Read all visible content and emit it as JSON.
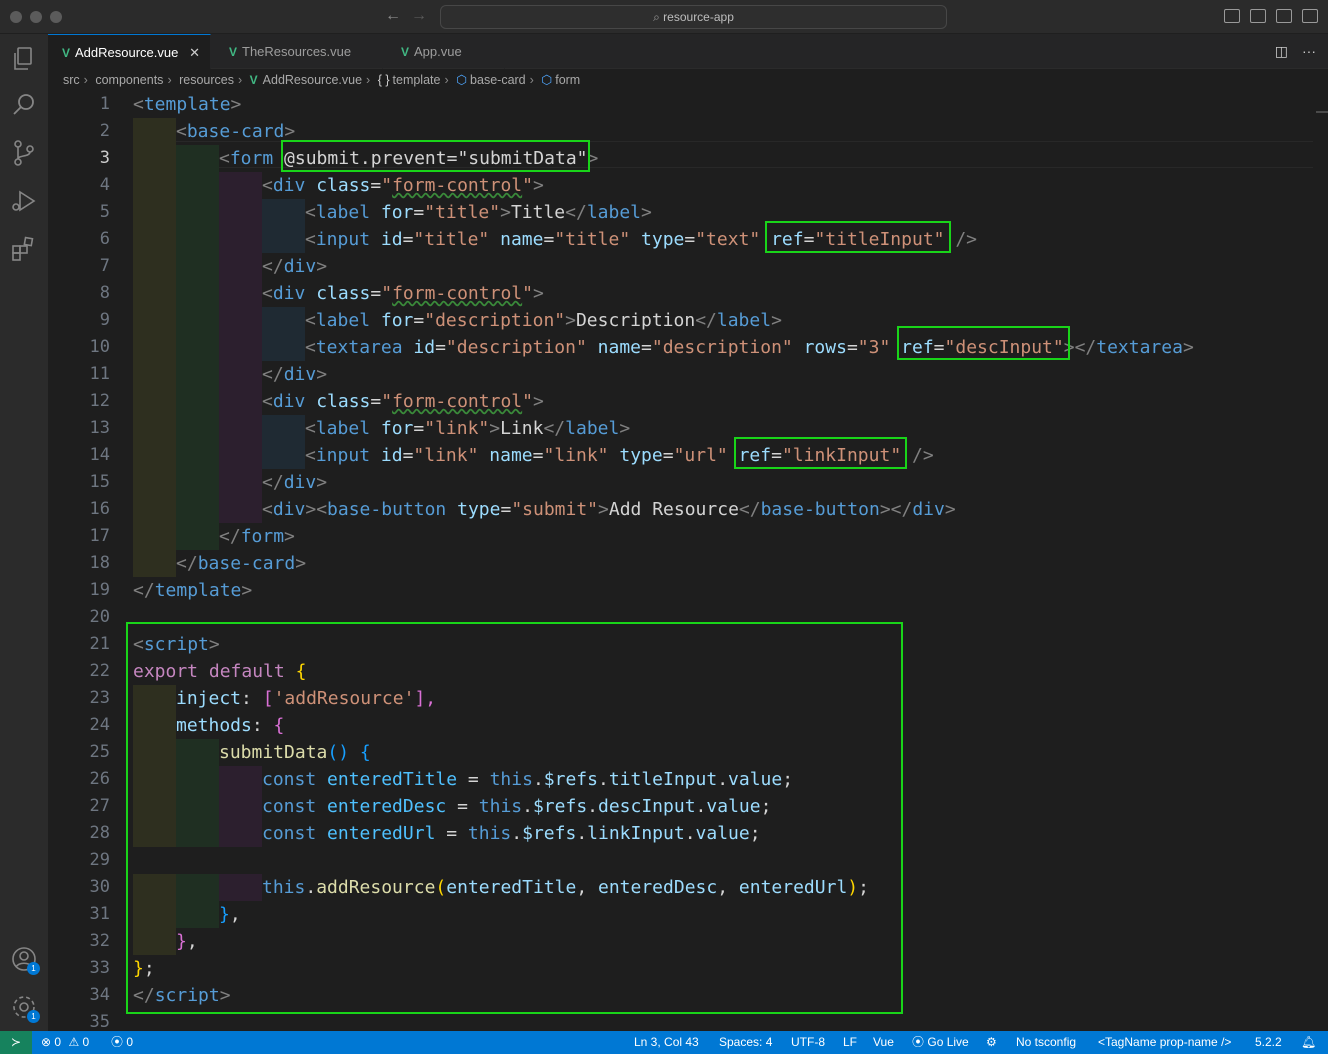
{
  "window": {
    "command_center": "resource-app"
  },
  "tabs": [
    {
      "label": "AddResource.vue",
      "active": true
    },
    {
      "label": "TheResources.vue",
      "active": false
    },
    {
      "label": "App.vue",
      "active": false
    }
  ],
  "breadcrumb": [
    "src",
    "components",
    "resources",
    "AddResource.vue",
    "template",
    "base-card",
    "form"
  ],
  "editor": {
    "line_numbers": [
      "1",
      "2",
      "3",
      "4",
      "5",
      "6",
      "7",
      "8",
      "9",
      "10",
      "11",
      "12",
      "13",
      "14",
      "15",
      "16",
      "17",
      "18",
      "19",
      "20",
      "21",
      "22",
      "23",
      "24",
      "25",
      "26",
      "27",
      "28",
      "29",
      "30",
      "31",
      "32",
      "33",
      "34",
      "35"
    ],
    "current_line": 3
  },
  "code": {
    "l1": [
      "<",
      "template",
      ">"
    ],
    "l2": [
      "<",
      "base-card",
      ">"
    ],
    "l3": [
      "<",
      "form",
      " ",
      "@submit.prevent",
      "=",
      "\"submitData\"",
      ">"
    ],
    "l4": [
      "<",
      "div",
      " ",
      "class",
      "=",
      "\"",
      "form-control",
      "\"",
      ">"
    ],
    "l5": [
      "<",
      "label",
      " ",
      "for",
      "=",
      "\"title\"",
      ">",
      "Title",
      "</",
      "label",
      ">"
    ],
    "l6": [
      "<",
      "input",
      " ",
      "id",
      "=",
      "\"title\"",
      " ",
      "name",
      "=",
      "\"title\"",
      " ",
      "type",
      "=",
      "\"text\"",
      " ",
      "ref",
      "=",
      "\"titleInput\"",
      " ",
      "/>"
    ],
    "l7": [
      "</",
      "div",
      ">"
    ],
    "l8": [
      "<",
      "div",
      " ",
      "class",
      "=",
      "\"",
      "form-control",
      "\"",
      ">"
    ],
    "l9": [
      "<",
      "label",
      " ",
      "for",
      "=",
      "\"description\"",
      ">",
      "Description",
      "</",
      "label",
      ">"
    ],
    "l10": [
      "<",
      "textarea",
      " ",
      "id",
      "=",
      "\"description\"",
      " ",
      "name",
      "=",
      "\"description\"",
      " ",
      "rows",
      "=",
      "\"3\"",
      " ",
      "ref",
      "=",
      "\"descInput\"",
      "></",
      "textarea",
      ">"
    ],
    "l11": [
      "</",
      "div",
      ">"
    ],
    "l12": [
      "<",
      "div",
      " ",
      "class",
      "=",
      "\"",
      "form-control",
      "\"",
      ">"
    ],
    "l13": [
      "<",
      "label",
      " ",
      "for",
      "=",
      "\"link\"",
      ">",
      "Link",
      "</",
      "label",
      ">"
    ],
    "l14": [
      "<",
      "input",
      " ",
      "id",
      "=",
      "\"link\"",
      " ",
      "name",
      "=",
      "\"link\"",
      " ",
      "type",
      "=",
      "\"url\"",
      " ",
      "ref",
      "=",
      "\"linkInput\"",
      " ",
      "/>"
    ],
    "l15": [
      "</",
      "div",
      ">"
    ],
    "l16": [
      "<",
      "div",
      "><",
      "base-button",
      " ",
      "type",
      "=",
      "\"submit\"",
      ">",
      "Add Resource",
      "</",
      "base-button",
      "></",
      "div",
      ">"
    ],
    "l17": [
      "</",
      "form",
      ">"
    ],
    "l18": [
      "</",
      "base-card",
      ">"
    ],
    "l19": [
      "</",
      "template",
      ">"
    ],
    "l21": [
      "<",
      "script",
      ">"
    ],
    "l22": [
      "export",
      " ",
      "default",
      " ",
      "{"
    ],
    "l23": [
      "inject",
      ": ",
      "[",
      "'addResource'",
      "],"
    ],
    "l24": [
      "methods",
      ": ",
      "{"
    ],
    "l25": [
      "submitData",
      "()",
      " ",
      "{"
    ],
    "l26": [
      "const",
      " ",
      "enteredTitle",
      " = ",
      "this",
      ".",
      "$refs",
      ".",
      "titleInput",
      ".",
      "value",
      ";"
    ],
    "l27": [
      "const",
      " ",
      "enteredDesc",
      " = ",
      "this",
      ".",
      "$refs",
      ".",
      "descInput",
      ".",
      "value",
      ";"
    ],
    "l28": [
      "const",
      " ",
      "enteredUrl",
      " = ",
      "this",
      ".",
      "$refs",
      ".",
      "linkInput",
      ".",
      "value",
      ";"
    ],
    "l30": [
      "this",
      ".",
      "addResource",
      "(",
      "enteredTitle",
      ", ",
      "enteredDesc",
      ", ",
      "enteredUrl",
      ")",
      ";"
    ],
    "l31": [
      "}",
      ","
    ],
    "l32": [
      "}",
      ","
    ],
    "l33": [
      "}",
      ";"
    ],
    "l34": [
      "</",
      "script",
      ">"
    ]
  },
  "activity_badges": {
    "accounts": "1",
    "manage": "1"
  },
  "statusbar": {
    "errors": "0",
    "warnings": "0",
    "ports": "0",
    "position": "Ln 3, Col 43",
    "spaces": "Spaces: 4",
    "encoding": "UTF-8",
    "eol": "LF",
    "language": "Vue",
    "golive": "Go Live",
    "tsconfig": "No tsconfig",
    "tagname": "<TagName prop-name />",
    "version": "5.2.2"
  }
}
